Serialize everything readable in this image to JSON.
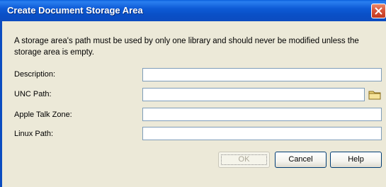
{
  "dialog": {
    "title": "Create Document Storage Area",
    "intro": "A storage area's path must be used by only one library and should never be modified unless the storage area is empty."
  },
  "fields": {
    "description": {
      "label": "Description:",
      "value": ""
    },
    "unc_path": {
      "label": "UNC Path:",
      "value": ""
    },
    "apple_talk_zone": {
      "label": "Apple Talk Zone:",
      "value": ""
    },
    "linux_path": {
      "label": "Linux Path:",
      "value": ""
    }
  },
  "buttons": {
    "ok": "OK",
    "cancel": "Cancel",
    "help": "Help"
  },
  "icons": {
    "close": "close-icon",
    "folder": "folder-icon"
  },
  "colors": {
    "titlebar": "#0a4fc6",
    "close": "#c2391f",
    "dialog_bg": "#ece9d8"
  }
}
